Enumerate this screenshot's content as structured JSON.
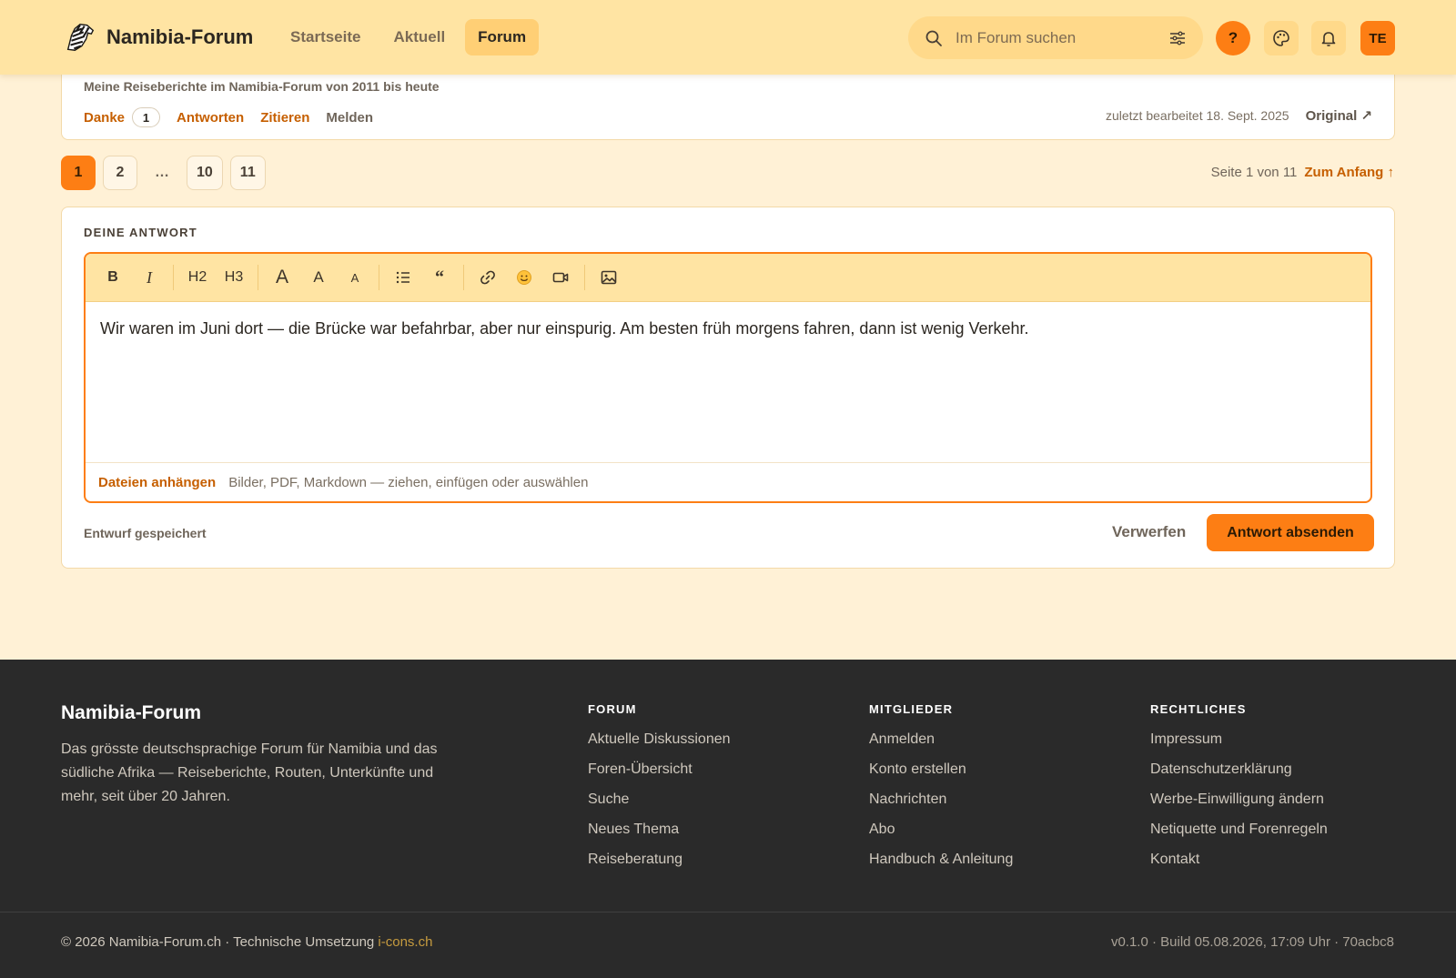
{
  "header": {
    "brand": "Namibia-Forum",
    "nav": [
      {
        "label": "Startseite"
      },
      {
        "label": "Aktuell"
      },
      {
        "label": "Forum",
        "active": true
      }
    ],
    "search_placeholder": "Im Forum suchen",
    "help_label": "?",
    "avatar_initials": "TE",
    "icons": [
      "zebra-logo-icon",
      "search-icon",
      "filter-icon",
      "palette-icon",
      "bell-icon"
    ]
  },
  "post": {
    "signature": "Meine Reiseberichte im Namibia-Forum von 2011 bis heute",
    "actions": {
      "thanks_label": "Danke",
      "thanks_count": "1",
      "reply_label": "Antworten",
      "quote_label": "Zitieren",
      "report_label": "Melden"
    },
    "edited": "zuletzt bearbeitet 18. Sept. 2025",
    "original_label": "Original ↗"
  },
  "pagination": {
    "pages": [
      "1",
      "2",
      "…",
      "10",
      "11"
    ],
    "current": "1",
    "info": "Seite 1 von 11",
    "top_link": "Zum Anfang ↑"
  },
  "reply": {
    "title": "DEINE ANTWORT",
    "toolbar": {
      "bold": "B",
      "italic": "I",
      "h2": "H2",
      "h3": "H3",
      "font_large": "A",
      "font_medium": "A",
      "font_small": "A",
      "quote": "“"
    },
    "body_text": "Wir waren im Juni dort — die Brücke war befahrbar, aber nur einspurig. Am besten früh morgens fahren, dann ist wenig Verkehr.",
    "attach_label": "Dateien anhängen",
    "attach_hint": "Bilder, PDF, Markdown — ziehen, einfügen oder auswählen",
    "draft_status": "Entwurf gespeichert",
    "discard_label": "Verwerfen",
    "submit_label": "Antwort absenden"
  },
  "footer": {
    "brand": "Namibia-Forum",
    "description": "Das grösste deutschsprachige Forum für Namibia und das südliche Afrika — Reiseberichte, Routen, Unterkünfte und mehr, seit über 20 Jahren.",
    "columns": [
      {
        "title": "FORUM",
        "links": [
          "Aktuelle Diskussionen",
          "Foren-Übersicht",
          "Suche",
          "Neues Thema",
          "Reiseberatung"
        ]
      },
      {
        "title": "MITGLIEDER",
        "links": [
          "Anmelden",
          "Konto erstellen",
          "Nachrichten",
          "Abo",
          "Handbuch & Anleitung"
        ]
      },
      {
        "title": "RECHTLICHES",
        "links": [
          "Impressum",
          "Datenschutzerklärung",
          "Werbe-Einwilligung ändern",
          "Netiquette und Forenregeln",
          "Kontakt"
        ]
      }
    ],
    "copyright": "© 2026 Namibia-Forum.ch · Technische Umsetzung ",
    "credit_link": "i-cons.ch",
    "build": "v0.1.0 · Build 05.08.2026, 17:09 Uhr · 70acbc8"
  },
  "colors": {
    "accent": "#fd7e14",
    "header_bg": "#ffe4a3",
    "page_bg": "#fff1d6",
    "link": "#c65f00",
    "footer_bg": "#2a2a2a"
  }
}
